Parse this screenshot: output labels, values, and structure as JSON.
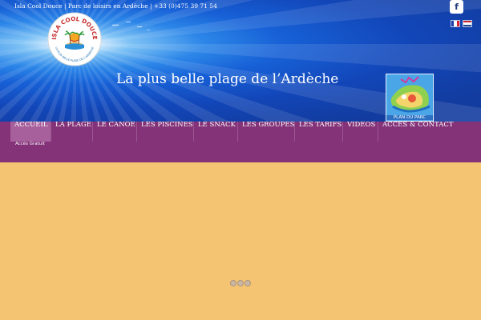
{
  "header": {
    "info_line": "Isla Cool Douce | Parc de loisirs en Ardèche | +33 (0)475 39 71 54",
    "tagline": "La plus belle plage de l’Ardèche",
    "facebook_label": "f",
    "logo": {
      "title": "ISLA COOL DOUCE",
      "subtitle": "LA PLUS BELLE PLAGE DE L'ARDECHE"
    },
    "park_map_label": "PLAN DU PARC",
    "languages": [
      "fr",
      "nl"
    ]
  },
  "nav": {
    "items": [
      {
        "label": "ACCUEIL",
        "active": true
      },
      {
        "label": "LA PLAGE"
      },
      {
        "label": "LE CANOE"
      },
      {
        "label": "LES PISCINES"
      },
      {
        "label": "LE SNACK"
      },
      {
        "label": "LES GROUPES"
      },
      {
        "label": "LES TARIFS"
      },
      {
        "label": "VIDEOS"
      },
      {
        "label": "ACCES & CONTACT"
      }
    ],
    "submenu": "Accès Gratuit"
  },
  "colors": {
    "nav_bg": "#843379",
    "nav_active": "#a7609c",
    "content_bg": "#f5c472",
    "sky_dark": "#123c9f"
  }
}
